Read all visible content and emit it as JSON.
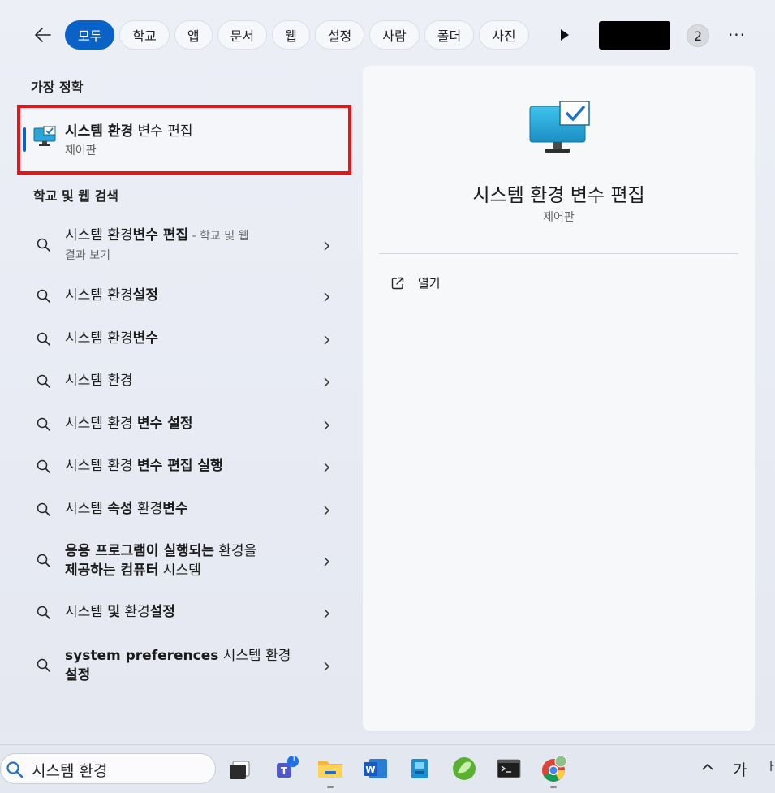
{
  "filters": {
    "chips": [
      "모두",
      "학교",
      "앱",
      "문서",
      "웹",
      "설정",
      "사람",
      "폴더",
      "사진"
    ],
    "active_index": 0,
    "badge_count": "2",
    "more_label": "···"
  },
  "best_match": {
    "heading": "가장 정확",
    "title_bold": "시스템 환경",
    "title_rest": " 변수 편집",
    "subtitle": "제어판"
  },
  "web_search": {
    "heading": "학교 및 웹 검색",
    "items": [
      {
        "parts": [
          [
            "시스템 환경",
            false
          ],
          [
            "변수 편집",
            true
          ]
        ],
        "suffix": " - 학교 및 웹",
        "line2": "결과 보기"
      },
      {
        "parts": [
          [
            "시스템 환경",
            false
          ],
          [
            "설정",
            true
          ]
        ]
      },
      {
        "parts": [
          [
            "시스템 환경",
            false
          ],
          [
            "변수",
            true
          ]
        ]
      },
      {
        "parts": [
          [
            "시스템 환경",
            false
          ]
        ]
      },
      {
        "parts": [
          [
            "시스템 환경 ",
            false
          ],
          [
            "변수 설정",
            true
          ]
        ]
      },
      {
        "parts": [
          [
            "시스템 환경 ",
            false
          ],
          [
            "변수 편집 실행",
            true
          ]
        ]
      },
      {
        "parts": [
          [
            "시스템 ",
            false
          ],
          [
            "속성",
            true
          ],
          [
            " 환경",
            false
          ],
          [
            "변수",
            true
          ]
        ]
      },
      {
        "parts": [
          [
            "응용 프로그램이 실행되는",
            true
          ],
          [
            " 환경을",
            false
          ]
        ],
        "line2_parts": [
          [
            "제공하는 컴퓨터",
            true
          ],
          [
            " 시스템",
            false
          ]
        ]
      },
      {
        "parts": [
          [
            "시스템 ",
            false
          ],
          [
            "및",
            true
          ],
          [
            " 환경",
            false
          ],
          [
            "설정",
            true
          ]
        ]
      },
      {
        "parts": [
          [
            "system preferences",
            true
          ],
          [
            " 시스템 환경",
            false
          ]
        ],
        "line2_parts": [
          [
            "설정",
            true
          ]
        ]
      }
    ]
  },
  "detail": {
    "title": "시스템 환경 변수 편집",
    "subtitle": "제어판",
    "open_label": "열기"
  },
  "taskbar": {
    "search_value": "시스템 환경",
    "teams_badge": "1",
    "ime_label": "가"
  },
  "colors": {
    "accent": "#0a62c6",
    "highlight_box": "#e0161b"
  }
}
